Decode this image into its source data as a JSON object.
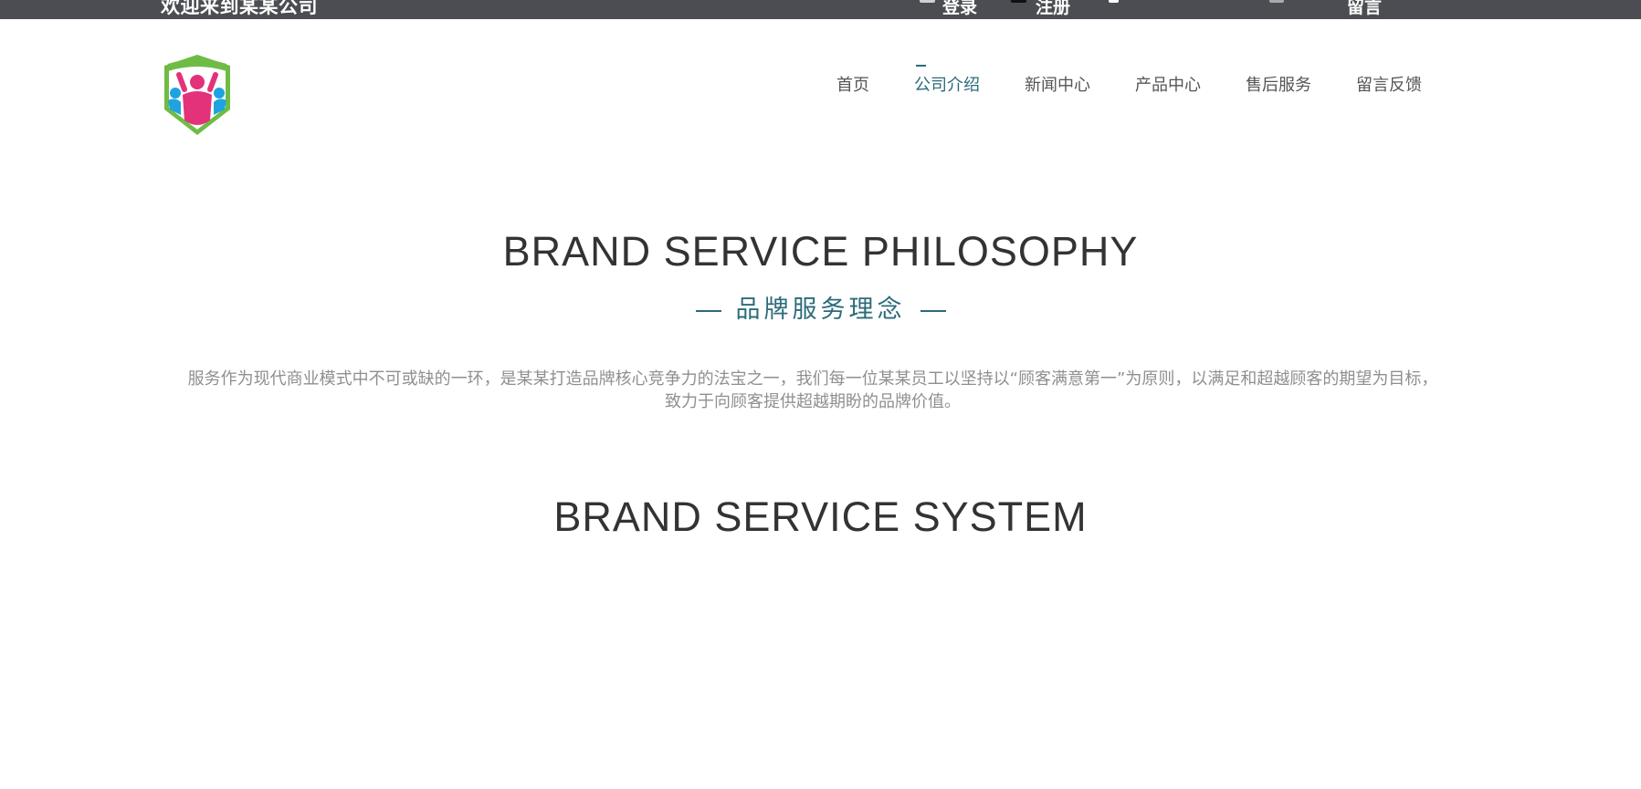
{
  "topbar": {
    "welcome": "欢迎来到某某公司",
    "items": [
      "登录",
      "注册",
      "",
      "",
      "留言"
    ],
    "colors": {
      "background": "#4b4d52"
    }
  },
  "nav": {
    "items": [
      "首页",
      "公司介绍",
      "新闻中心",
      "产品中心",
      "售后服务",
      "留言反馈"
    ],
    "active_index": 1,
    "active_color": "#2b6b7a"
  },
  "philosophy": {
    "title": "BRAND SERVICE PHILOSOPHY",
    "subtitle": "品牌服务理念",
    "description": "服务作为现代商业模式中不可或缺的一环，是某某打造品牌核心竞争力的法宝之一，我们每一位某某员工以坚持以“顾客满意第一”为原则，以满足和超越顾客的期望为目标，致力于向顾客提供超越期盼的品牌价值。"
  },
  "system": {
    "title": "BRAND SERVICE SYSTEM"
  },
  "icons": {
    "logo": "child-welfare-badge-logo",
    "topbar": [
      "user-icon",
      "register-icon",
      "phone-icon",
      "mail-icon"
    ]
  }
}
